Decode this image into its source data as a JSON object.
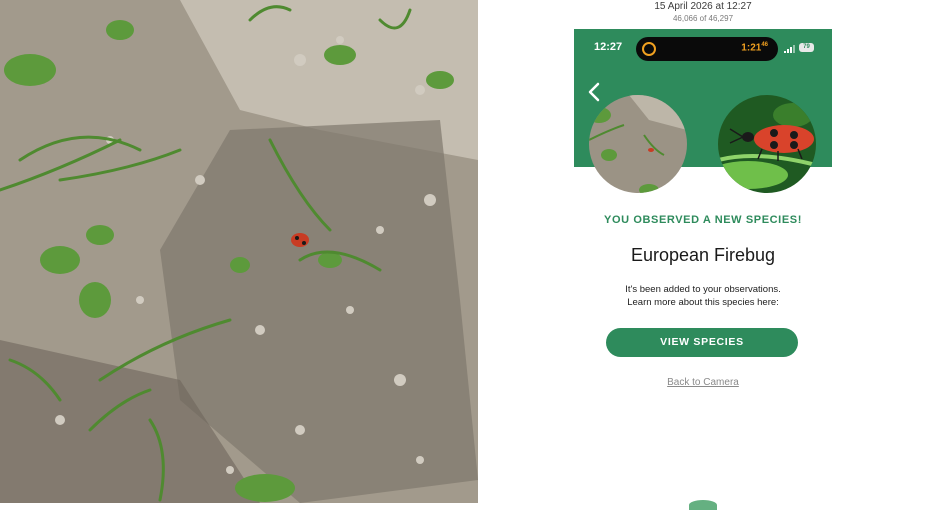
{
  "photo": {
    "subject": "observation-photo"
  },
  "screenshot_meta": {
    "date": "15 April 2026 at 12:27",
    "count": "46,066 of 46,297"
  },
  "status_bar": {
    "time": "12:27",
    "timer": "1:21",
    "timer_seconds": "46",
    "battery": "79"
  },
  "header": {
    "back_icon": "chevron-left-icon"
  },
  "content": {
    "heading": "YOU OBSERVED A NEW SPECIES!",
    "species_name": "European Firebug",
    "added_line1": "It's been added to your observations.",
    "added_line2": "Learn more about this species here:",
    "view_button": "VIEW SPECIES",
    "back_link": "Back to Camera"
  },
  "colors": {
    "brand_green": "#2e8b5c",
    "timer_orange": "#f0a020"
  }
}
